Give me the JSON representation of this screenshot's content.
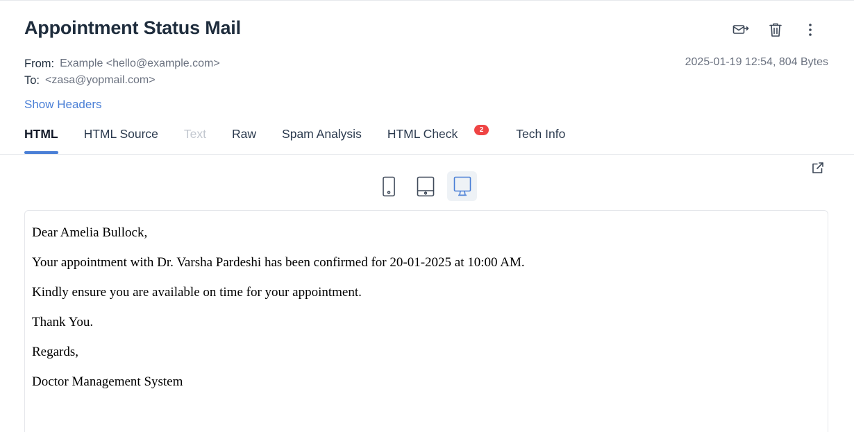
{
  "email": {
    "subject": "Appointment Status Mail",
    "from_label": "From:",
    "from_value": "Example <hello@example.com>",
    "to_label": "To:",
    "to_value": "<zasa@yopmail.com>",
    "meta": "2025-01-19 12:54, 804 Bytes",
    "show_headers": "Show Headers"
  },
  "actions": [
    {
      "icon": "forward-mail-icon"
    },
    {
      "icon": "trash-icon"
    },
    {
      "icon": "more-vertical-icon"
    }
  ],
  "tabs": [
    {
      "label": "HTML",
      "state": "active"
    },
    {
      "label": "HTML Source",
      "state": "normal"
    },
    {
      "label": "Text",
      "state": "disabled"
    },
    {
      "label": "Raw",
      "state": "normal"
    },
    {
      "label": "Spam Analysis",
      "state": "normal"
    },
    {
      "label": "HTML Check",
      "state": "normal",
      "badge": "2"
    },
    {
      "label": "Tech Info",
      "state": "normal"
    }
  ],
  "devices": [
    {
      "icon": "mobile-icon",
      "active": false
    },
    {
      "icon": "tablet-icon",
      "active": false
    },
    {
      "icon": "desktop-icon",
      "active": true
    }
  ],
  "body_lines": [
    "Dear Amelia Bullock,",
    "Your appointment with Dr. Varsha Pardeshi has been confirmed for 20-01-2025 at 10:00 AM.",
    "Kindly ensure you are available on time for your appointment.",
    "Thank You.",
    "Regards,",
    "Doctor Management System"
  ],
  "colors": {
    "accent": "#4a7fd6",
    "badge": "#ef4444",
    "text": "#1f2d3d",
    "muted": "#6b7280"
  }
}
